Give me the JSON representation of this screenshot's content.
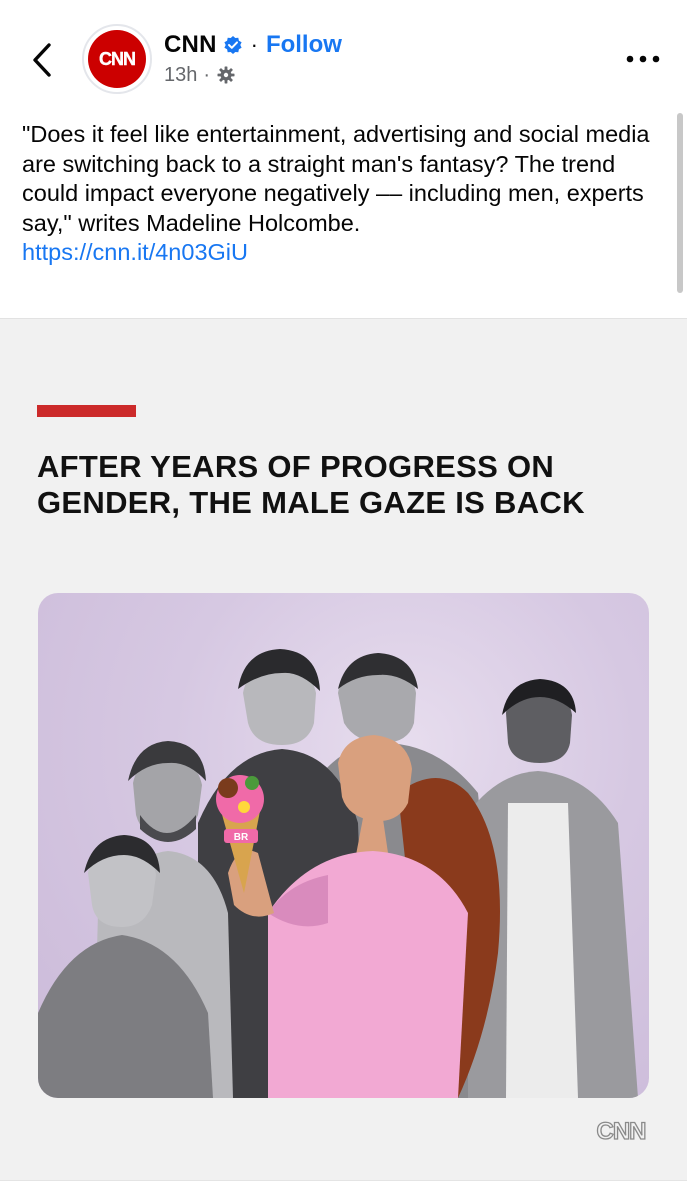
{
  "header": {
    "page_name": "CNN",
    "follow_label": "Follow",
    "time": "13h",
    "separator": "·"
  },
  "post": {
    "caption": "\"Does it feel like entertainment, advertising and social media are switching back to a straight man's fantasy? The trend could impact everyone negatively –– including men, experts say,\" writes Madeline Holcombe.",
    "link": "https://cnn.it/4n03GiU"
  },
  "card": {
    "headline_line1": "AFTER YEARS OF PROGRESS ON",
    "headline_line2": "GENDER, THE MALE GAZE IS BACK",
    "logo_text": "CNN",
    "cone_text": "BR"
  },
  "colors": {
    "accent": "#1877f2",
    "brand_red": "#cc0000",
    "headline_bar": "#cc2a2a",
    "card_background": "#f1f1f1",
    "photo_background": "#d6c8e2",
    "dress_pink": "#f2a9d3"
  },
  "icons": {
    "back": "chevron-left-icon",
    "verified": "verified-badge-icon",
    "privacy": "globe-gear-icon",
    "more": "more-horizontal-icon"
  }
}
